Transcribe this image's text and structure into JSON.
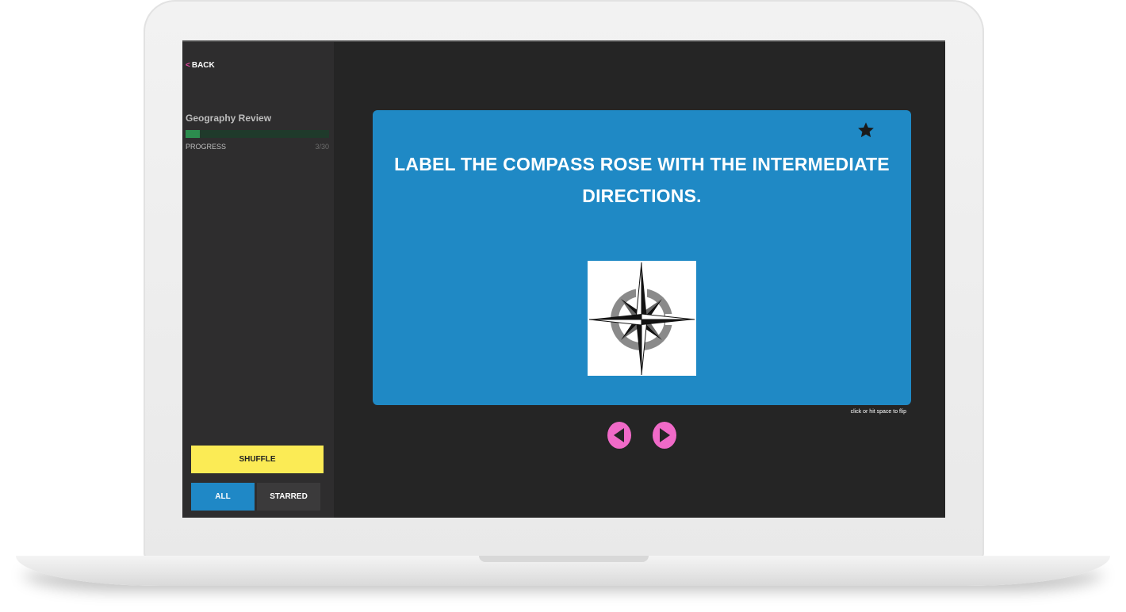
{
  "sidebar": {
    "back_label": "BACK",
    "deck_title": "Geography Review",
    "progress_label": "PROGRESS",
    "progress_count": "3/30",
    "progress_fraction": 0.1,
    "shuffle_label": "SHUFFLE",
    "filters": {
      "all_label": "ALL",
      "starred_label": "STARRED",
      "selected": "ALL"
    }
  },
  "card": {
    "question": "LABEL THE COMPASS ROSE WITH THE INTERMEDIATE DIRECTIONS.",
    "image": "compass-rose",
    "starred": true
  },
  "hint": "click or hit space to flip",
  "nav": {
    "prev_icon": "arrow-left-icon",
    "next_icon": "arrow-right-icon"
  },
  "colors": {
    "card": "#1f89c5",
    "shuffle": "#fbeb55",
    "nav": "#f06ac8",
    "progress": "#2c8c4e",
    "back_chevron": "#e94aa5"
  }
}
